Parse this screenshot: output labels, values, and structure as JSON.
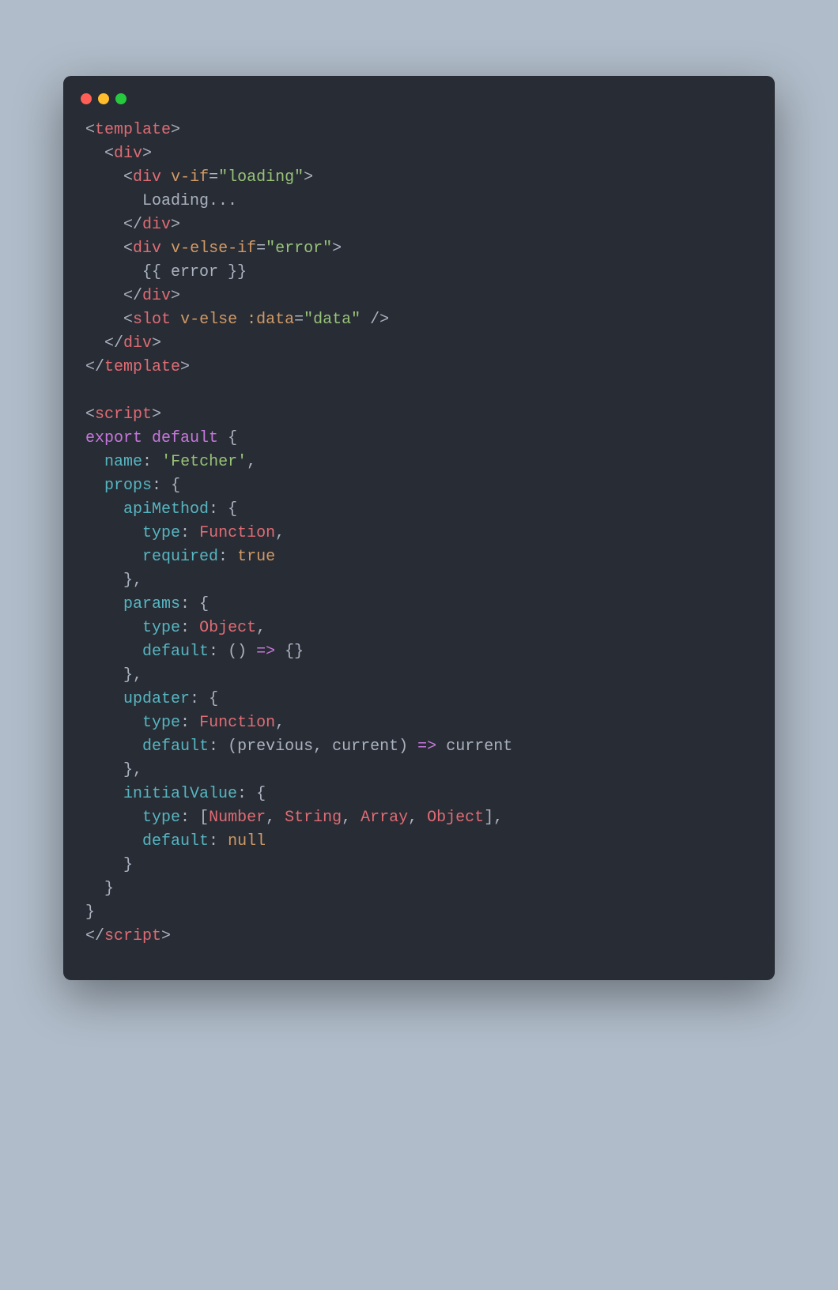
{
  "window": {
    "traffic_lights": [
      "close",
      "minimize",
      "maximize"
    ]
  },
  "code": {
    "language": "vue",
    "tokens": [
      [
        {
          "t": "tagpunct",
          "v": "<"
        },
        {
          "t": "tag",
          "v": "template"
        },
        {
          "t": "tagpunct",
          "v": ">"
        }
      ],
      [
        {
          "t": "text",
          "v": "  "
        },
        {
          "t": "tagpunct",
          "v": "<"
        },
        {
          "t": "tag",
          "v": "div"
        },
        {
          "t": "tagpunct",
          "v": ">"
        }
      ],
      [
        {
          "t": "text",
          "v": "    "
        },
        {
          "t": "tagpunct",
          "v": "<"
        },
        {
          "t": "tag",
          "v": "div"
        },
        {
          "t": "text",
          "v": " "
        },
        {
          "t": "attr",
          "v": "v-if"
        },
        {
          "t": "tagpunct",
          "v": "="
        },
        {
          "t": "str",
          "v": "\"loading\""
        },
        {
          "t": "tagpunct",
          "v": ">"
        }
      ],
      [
        {
          "t": "text",
          "v": "      Loading..."
        }
      ],
      [
        {
          "t": "text",
          "v": "    "
        },
        {
          "t": "tagpunct",
          "v": "</"
        },
        {
          "t": "tag",
          "v": "div"
        },
        {
          "t": "tagpunct",
          "v": ">"
        }
      ],
      [
        {
          "t": "text",
          "v": "    "
        },
        {
          "t": "tagpunct",
          "v": "<"
        },
        {
          "t": "tag",
          "v": "div"
        },
        {
          "t": "text",
          "v": " "
        },
        {
          "t": "attr",
          "v": "v-else-if"
        },
        {
          "t": "tagpunct",
          "v": "="
        },
        {
          "t": "str",
          "v": "\"error\""
        },
        {
          "t": "tagpunct",
          "v": ">"
        }
      ],
      [
        {
          "t": "text",
          "v": "      {{ error }}"
        }
      ],
      [
        {
          "t": "text",
          "v": "    "
        },
        {
          "t": "tagpunct",
          "v": "</"
        },
        {
          "t": "tag",
          "v": "div"
        },
        {
          "t": "tagpunct",
          "v": ">"
        }
      ],
      [
        {
          "t": "text",
          "v": "    "
        },
        {
          "t": "tagpunct",
          "v": "<"
        },
        {
          "t": "tag",
          "v": "slot"
        },
        {
          "t": "text",
          "v": " "
        },
        {
          "t": "attr",
          "v": "v-else"
        },
        {
          "t": "text",
          "v": " "
        },
        {
          "t": "attr",
          "v": ":data"
        },
        {
          "t": "tagpunct",
          "v": "="
        },
        {
          "t": "str",
          "v": "\"data\""
        },
        {
          "t": "text",
          "v": " "
        },
        {
          "t": "tagpunct",
          "v": "/>"
        }
      ],
      [
        {
          "t": "text",
          "v": "  "
        },
        {
          "t": "tagpunct",
          "v": "</"
        },
        {
          "t": "tag",
          "v": "div"
        },
        {
          "t": "tagpunct",
          "v": ">"
        }
      ],
      [
        {
          "t": "tagpunct",
          "v": "</"
        },
        {
          "t": "tag",
          "v": "template"
        },
        {
          "t": "tagpunct",
          "v": ">"
        }
      ],
      [
        {
          "t": "text",
          "v": ""
        }
      ],
      [
        {
          "t": "tagpunct",
          "v": "<"
        },
        {
          "t": "tag",
          "v": "script"
        },
        {
          "t": "tagpunct",
          "v": ">"
        }
      ],
      [
        {
          "t": "kw",
          "v": "export"
        },
        {
          "t": "text",
          "v": " "
        },
        {
          "t": "kw",
          "v": "default"
        },
        {
          "t": "text",
          "v": " "
        },
        {
          "t": "brace",
          "v": "{"
        }
      ],
      [
        {
          "t": "text",
          "v": "  "
        },
        {
          "t": "prop",
          "v": "name"
        },
        {
          "t": "punct",
          "v": ":"
        },
        {
          "t": "text",
          "v": " "
        },
        {
          "t": "str",
          "v": "'Fetcher'"
        },
        {
          "t": "punct",
          "v": ","
        }
      ],
      [
        {
          "t": "text",
          "v": "  "
        },
        {
          "t": "prop",
          "v": "props"
        },
        {
          "t": "punct",
          "v": ":"
        },
        {
          "t": "text",
          "v": " "
        },
        {
          "t": "brace",
          "v": "{"
        }
      ],
      [
        {
          "t": "text",
          "v": "    "
        },
        {
          "t": "prop",
          "v": "apiMethod"
        },
        {
          "t": "punct",
          "v": ":"
        },
        {
          "t": "text",
          "v": " "
        },
        {
          "t": "brace",
          "v": "{"
        }
      ],
      [
        {
          "t": "text",
          "v": "      "
        },
        {
          "t": "prop",
          "v": "type"
        },
        {
          "t": "punct",
          "v": ":"
        },
        {
          "t": "text",
          "v": " "
        },
        {
          "t": "type",
          "v": "Function"
        },
        {
          "t": "punct",
          "v": ","
        }
      ],
      [
        {
          "t": "text",
          "v": "      "
        },
        {
          "t": "prop",
          "v": "required"
        },
        {
          "t": "punct",
          "v": ":"
        },
        {
          "t": "text",
          "v": " "
        },
        {
          "t": "const",
          "v": "true"
        }
      ],
      [
        {
          "t": "text",
          "v": "    "
        },
        {
          "t": "brace",
          "v": "}"
        },
        {
          "t": "punct",
          "v": ","
        }
      ],
      [
        {
          "t": "text",
          "v": "    "
        },
        {
          "t": "prop",
          "v": "params"
        },
        {
          "t": "punct",
          "v": ":"
        },
        {
          "t": "text",
          "v": " "
        },
        {
          "t": "brace",
          "v": "{"
        }
      ],
      [
        {
          "t": "text",
          "v": "      "
        },
        {
          "t": "prop",
          "v": "type"
        },
        {
          "t": "punct",
          "v": ":"
        },
        {
          "t": "text",
          "v": " "
        },
        {
          "t": "type",
          "v": "Object"
        },
        {
          "t": "punct",
          "v": ","
        }
      ],
      [
        {
          "t": "text",
          "v": "      "
        },
        {
          "t": "prop",
          "v": "default"
        },
        {
          "t": "punct",
          "v": ":"
        },
        {
          "t": "text",
          "v": " "
        },
        {
          "t": "punct",
          "v": "()"
        },
        {
          "t": "text",
          "v": " "
        },
        {
          "t": "arrow",
          "v": "=>"
        },
        {
          "t": "text",
          "v": " "
        },
        {
          "t": "brace",
          "v": "{}"
        }
      ],
      [
        {
          "t": "text",
          "v": "    "
        },
        {
          "t": "brace",
          "v": "}"
        },
        {
          "t": "punct",
          "v": ","
        }
      ],
      [
        {
          "t": "text",
          "v": "    "
        },
        {
          "t": "prop",
          "v": "updater"
        },
        {
          "t": "punct",
          "v": ":"
        },
        {
          "t": "text",
          "v": " "
        },
        {
          "t": "brace",
          "v": "{"
        }
      ],
      [
        {
          "t": "text",
          "v": "      "
        },
        {
          "t": "prop",
          "v": "type"
        },
        {
          "t": "punct",
          "v": ":"
        },
        {
          "t": "text",
          "v": " "
        },
        {
          "t": "type",
          "v": "Function"
        },
        {
          "t": "punct",
          "v": ","
        }
      ],
      [
        {
          "t": "text",
          "v": "      "
        },
        {
          "t": "prop",
          "v": "default"
        },
        {
          "t": "punct",
          "v": ":"
        },
        {
          "t": "text",
          "v": " "
        },
        {
          "t": "punct",
          "v": "("
        },
        {
          "t": "param",
          "v": "previous"
        },
        {
          "t": "punct",
          "v": ", "
        },
        {
          "t": "param",
          "v": "current"
        },
        {
          "t": "punct",
          "v": ")"
        },
        {
          "t": "text",
          "v": " "
        },
        {
          "t": "arrow",
          "v": "=>"
        },
        {
          "t": "text",
          "v": " "
        },
        {
          "t": "param",
          "v": "current"
        }
      ],
      [
        {
          "t": "text",
          "v": "    "
        },
        {
          "t": "brace",
          "v": "}"
        },
        {
          "t": "punct",
          "v": ","
        }
      ],
      [
        {
          "t": "text",
          "v": "    "
        },
        {
          "t": "prop",
          "v": "initialValue"
        },
        {
          "t": "punct",
          "v": ":"
        },
        {
          "t": "text",
          "v": " "
        },
        {
          "t": "brace",
          "v": "{"
        }
      ],
      [
        {
          "t": "text",
          "v": "      "
        },
        {
          "t": "prop",
          "v": "type"
        },
        {
          "t": "punct",
          "v": ":"
        },
        {
          "t": "text",
          "v": " "
        },
        {
          "t": "punct",
          "v": "["
        },
        {
          "t": "type",
          "v": "Number"
        },
        {
          "t": "punct",
          "v": ", "
        },
        {
          "t": "type",
          "v": "String"
        },
        {
          "t": "punct",
          "v": ", "
        },
        {
          "t": "type",
          "v": "Array"
        },
        {
          "t": "punct",
          "v": ", "
        },
        {
          "t": "type",
          "v": "Object"
        },
        {
          "t": "punct",
          "v": "],"
        }
      ],
      [
        {
          "t": "text",
          "v": "      "
        },
        {
          "t": "prop",
          "v": "default"
        },
        {
          "t": "punct",
          "v": ":"
        },
        {
          "t": "text",
          "v": " "
        },
        {
          "t": "const",
          "v": "null"
        }
      ],
      [
        {
          "t": "text",
          "v": "    "
        },
        {
          "t": "brace",
          "v": "}"
        }
      ],
      [
        {
          "t": "text",
          "v": "  "
        },
        {
          "t": "brace",
          "v": "}"
        }
      ],
      [
        {
          "t": "brace",
          "v": "}"
        }
      ],
      [
        {
          "t": "tagpunct",
          "v": "</"
        },
        {
          "t": "tag",
          "v": "script"
        },
        {
          "t": "tagpunct",
          "v": ">"
        }
      ]
    ]
  }
}
